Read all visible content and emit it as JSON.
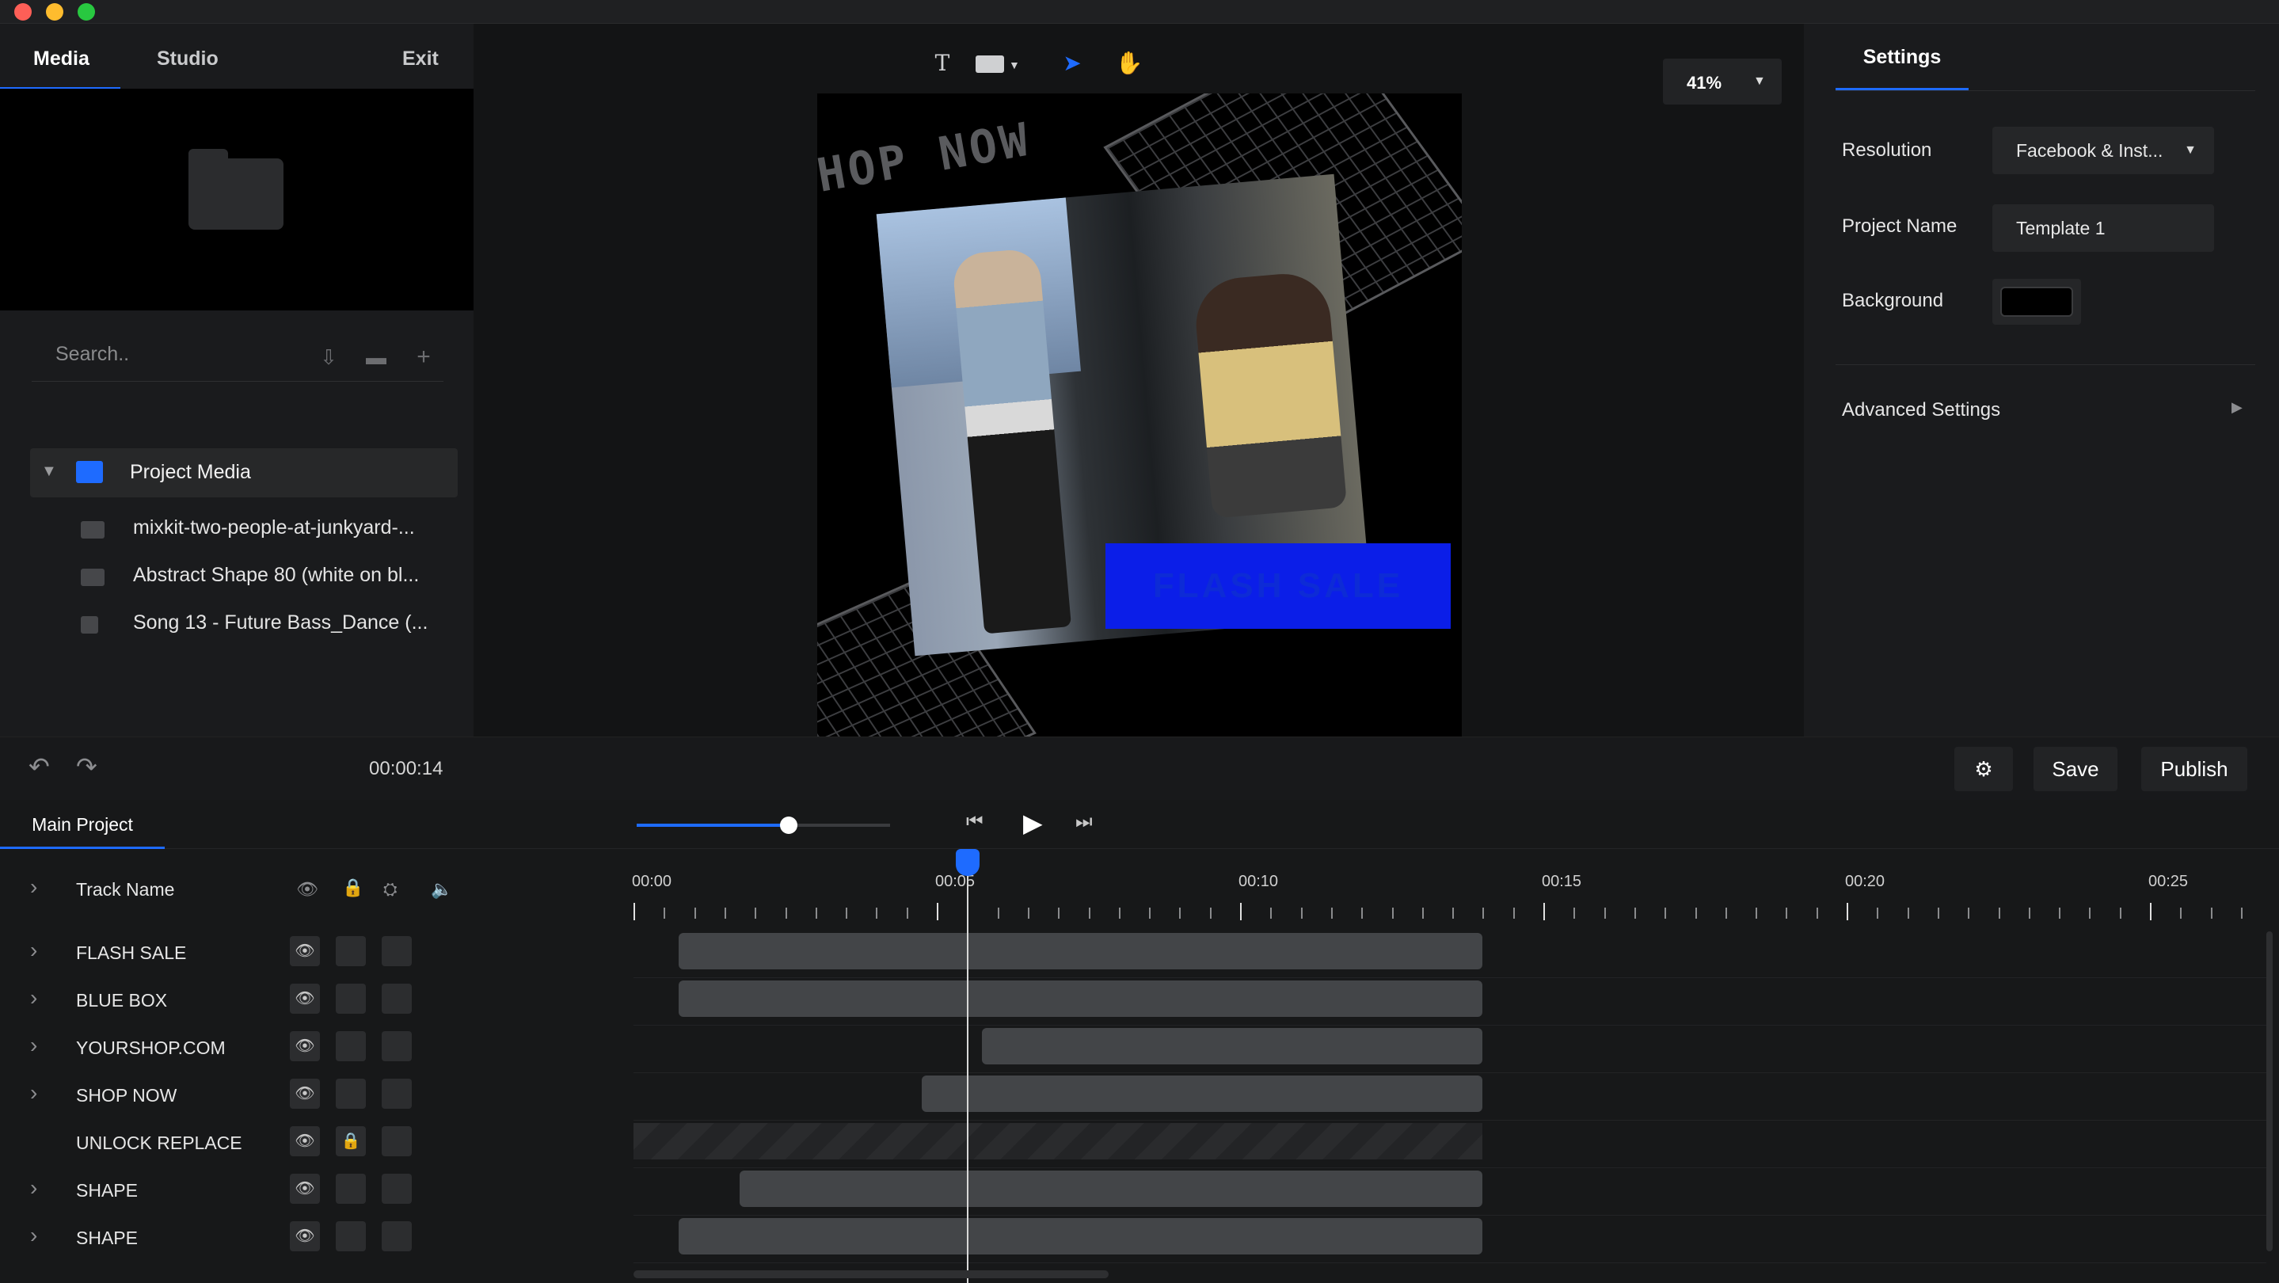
{
  "left_panel": {
    "tabs": [
      "Media",
      "Studio"
    ],
    "exit_label": "Exit",
    "search_placeholder": "Search..",
    "project_media_label": "Project Media",
    "media_items": [
      "mixkit-two-people-at-junkyard-...",
      "Abstract Shape 80 (white on bl...",
      "Song 13 - Future Bass_Dance (..."
    ]
  },
  "toolbar": {
    "zoom_label": "41%"
  },
  "canvas": {
    "shop_now_text": "SHOP NOW",
    "flash_sale_text": "FLASH SALE"
  },
  "settings": {
    "tab_label": "Settings",
    "resolution_label": "Resolution",
    "resolution_value": "Facebook & Inst...",
    "project_name_label": "Project Name",
    "project_name_value": "Template 1",
    "background_label": "Background",
    "background_color": "#000000",
    "advanced_label": "Advanced Settings"
  },
  "controls": {
    "timecode": "00:00:14",
    "save_label": "Save",
    "publish_label": "Publish"
  },
  "timeline": {
    "main_tab": "Main Project",
    "header_label": "Track Name",
    "volume_fraction": 0.6,
    "time_labels": [
      "00:00",
      "00:05",
      "00:10",
      "00:15",
      "00:20",
      "00:25"
    ],
    "tracks": [
      {
        "name": "FLASH SALE",
        "expandable": true,
        "locked": false,
        "start": 0.75,
        "end": 14.0
      },
      {
        "name": "BLUE BOX",
        "expandable": true,
        "locked": false,
        "start": 0.75,
        "end": 14.0
      },
      {
        "name": "YOURSHOP.COM",
        "expandable": true,
        "locked": false,
        "start": 5.75,
        "end": 14.0
      },
      {
        "name": "SHOP NOW",
        "expandable": true,
        "locked": false,
        "start": 4.75,
        "end": 14.0
      },
      {
        "name": "UNLOCK REPLACE",
        "expandable": false,
        "locked": true,
        "start": 0.0,
        "end": 14.0
      },
      {
        "name": "SHAPE",
        "expandable": true,
        "locked": false,
        "start": 1.75,
        "end": 14.0
      },
      {
        "name": "SHAPE",
        "expandable": true,
        "locked": false,
        "start": 0.75,
        "end": 14.0
      }
    ],
    "playhead_time": 5.5
  },
  "colors": {
    "accent": "#1e6bff",
    "flash_box": "#0b1ee8"
  }
}
